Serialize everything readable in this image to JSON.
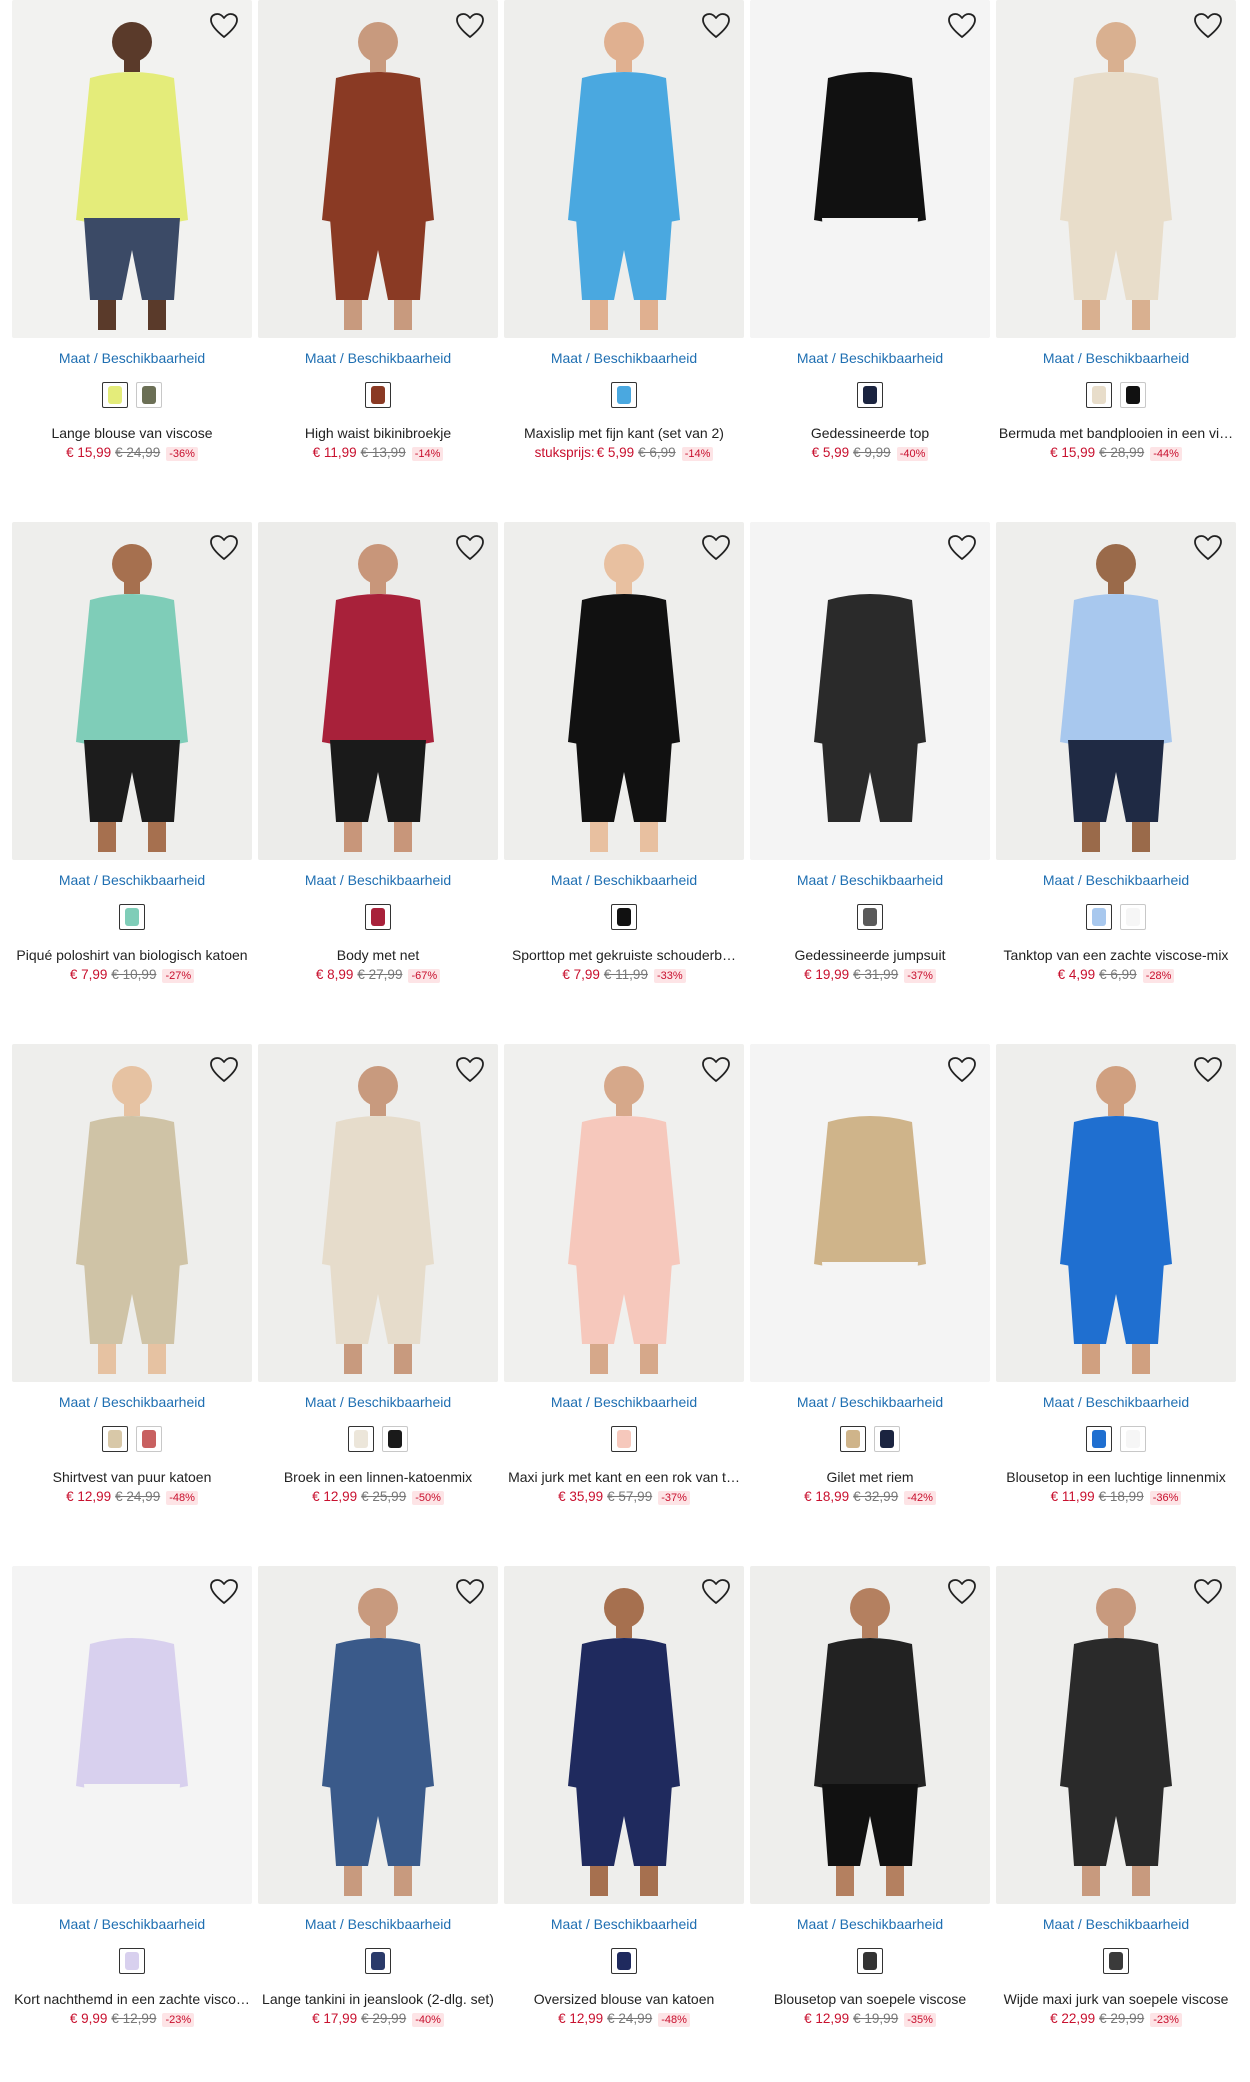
{
  "ui": {
    "maat_label": "Maat / Beschikbaarheid",
    "wishlist_icon": "heart-outline-icon",
    "colors": {
      "price": "#c8102e",
      "link": "#1f6fb2",
      "discount_bg": "#fde4e6"
    }
  },
  "products": [
    {
      "title": "Lange blouse van viscose",
      "price": "€ 15,99",
      "old_price": "€ 24,99",
      "discount": "-36%",
      "bg": "#f2f2f0",
      "main": "#e4ec7a",
      "skin": "#5a3a2a",
      "bottom": "#3b4a66",
      "swatches": [
        "#e4ec7a",
        "#6b6f55"
      ]
    },
    {
      "title": "High waist bikinibroekje",
      "price": "€ 11,99",
      "old_price": "€ 13,99",
      "discount": "-14%",
      "bg": "#eeeeec",
      "main": "#8a3a24",
      "skin": "#c89a7e",
      "bottom": "#8a3a24",
      "swatches": [
        "#8a3a24"
      ]
    },
    {
      "title": "Maxislip met fijn kant (set van 2)",
      "unit_label": "stuksprijs:",
      "price": "€ 5,99",
      "old_price": "€ 6,99",
      "discount": "-14%",
      "bg": "#eeeeec",
      "main": "#4aa8e0",
      "skin": "#e0b090",
      "bottom": "#4aa8e0",
      "swatches": [
        "#4aa8e0"
      ]
    },
    {
      "title": "Gedessineerde top",
      "price": "€ 5,99",
      "old_price": "€ 9,99",
      "discount": "-40%",
      "bg": "#f4f4f4",
      "main": "#111111",
      "skin": "#f4f4f4",
      "bottom": "#f4f4f4",
      "swatches": [
        "#1b2440"
      ]
    },
    {
      "title": "Bermuda met bandplooien in een vi…",
      "price": "€ 15,99",
      "old_price": "€ 28,99",
      "discount": "-44%",
      "bg": "#f0f0ee",
      "main": "#e8ddca",
      "skin": "#d9b090",
      "bottom": "#e8ddca",
      "swatches": [
        "#e8ddca",
        "#111111"
      ]
    },
    {
      "title": "Piqué poloshirt van biologisch katoen",
      "price": "€ 7,99",
      "old_price": "€ 10,99",
      "discount": "-27%",
      "bg": "#eeeeec",
      "main": "#7fcdb8",
      "skin": "#a6704f",
      "bottom": "#1c1c1c",
      "swatches": [
        "#7fcdb8"
      ]
    },
    {
      "title": "Body met net",
      "price": "€ 8,99",
      "old_price": "€ 27,99",
      "discount": "-67%",
      "bg": "#ececea",
      "main": "#a8213a",
      "skin": "#c8967a",
      "bottom": "#1a1a1a",
      "swatches": [
        "#a8213a"
      ]
    },
    {
      "title": "Sporttop met gekruiste schouderb…",
      "price": "€ 7,99",
      "old_price": "€ 11,99",
      "discount": "-33%",
      "bg": "#eeeeec",
      "main": "#111111",
      "skin": "#e8c0a0",
      "bottom": "#111111",
      "swatches": [
        "#111111"
      ]
    },
    {
      "title": "Gedessineerde jumpsuit",
      "price": "€ 19,99",
      "old_price": "€ 31,99",
      "discount": "-37%",
      "bg": "#f4f4f4",
      "main": "#2a2a2a",
      "skin": "#f4f4f4",
      "bottom": "#2a2a2a",
      "swatches": [
        "#5a5a5a"
      ]
    },
    {
      "title": "Tanktop van een zachte viscose-mix",
      "price": "€ 4,99",
      "old_price": "€ 6,99",
      "discount": "-28%",
      "bg": "#eeeeec",
      "main": "#a8c8ee",
      "skin": "#9a6a4a",
      "bottom": "#1f2a44",
      "swatches": [
        "#a8c8ee",
        "#f6f6f6"
      ]
    },
    {
      "title": "Shirtvest van puur katoen",
      "price": "€ 12,99",
      "old_price": "€ 24,99",
      "discount": "-48%",
      "bg": "#eeeeec",
      "main": "#cfc3a6",
      "skin": "#e6c2a2",
      "bottom": "#cfc3a6",
      "swatches": [
        "#d8c8a8",
        "#c86060"
      ]
    },
    {
      "title": "Broek in een linnen-katoenmix",
      "price": "€ 12,99",
      "old_price": "€ 25,99",
      "discount": "-50%",
      "bg": "#eeeeec",
      "main": "#e6dccb",
      "skin": "#c89a7e",
      "bottom": "#e6dccb",
      "swatches": [
        "#ece6da",
        "#1a1a1a"
      ]
    },
    {
      "title": "Maxi jurk met kant en een rok van t…",
      "price": "€ 35,99",
      "old_price": "€ 57,99",
      "discount": "-37%",
      "bg": "#f0f0ee",
      "main": "#f6c8bc",
      "skin": "#d6a88a",
      "bottom": "#f6c8bc",
      "swatches": [
        "#f6c8bc"
      ]
    },
    {
      "title": "Gilet met riem",
      "price": "€ 18,99",
      "old_price": "€ 32,99",
      "discount": "-42%",
      "bg": "#f4f4f4",
      "main": "#cfb48a",
      "skin": "#f4f4f4",
      "bottom": "#f4f4f4",
      "swatches": [
        "#cfb48a",
        "#1b2440"
      ]
    },
    {
      "title": "Blousetop in een luchtige linnenmix",
      "price": "€ 11,99",
      "old_price": "€ 18,99",
      "discount": "-36%",
      "bg": "#eeeeec",
      "main": "#1f6fd0",
      "skin": "#d0a080",
      "bottom": "#1f6fd0",
      "swatches": [
        "#1f6fd0",
        "#f6f6f6"
      ]
    },
    {
      "title": "Kort nachthemd in een zachte visco…",
      "price": "€ 9,99",
      "old_price": "€ 12,99",
      "discount": "-23%",
      "bg": "#f4f4f4",
      "main": "#d8d0ee",
      "skin": "#f4f4f4",
      "bottom": "#f4f4f4",
      "swatches": [
        "#d8d0ee"
      ]
    },
    {
      "title": "Lange tankini in jeanslook (2-dlg. set)",
      "price": "€ 17,99",
      "old_price": "€ 29,99",
      "discount": "-40%",
      "bg": "#eeeeec",
      "main": "#3a5a8a",
      "skin": "#c89a7e",
      "bottom": "#3a5a8a",
      "swatches": [
        "#2a3a6a"
      ]
    },
    {
      "title": "Oversized blouse van katoen",
      "price": "€ 12,99",
      "old_price": "€ 24,99",
      "discount": "-48%",
      "bg": "#eeeeec",
      "main": "#1f2a5e",
      "skin": "#a6704f",
      "bottom": "#1f2a5e",
      "swatches": [
        "#1f2a5e"
      ]
    },
    {
      "title": "Blousetop van soepele viscose",
      "price": "€ 12,99",
      "old_price": "€ 19,99",
      "discount": "-35%",
      "bg": "#eeeeec",
      "main": "#222222",
      "skin": "#b48060",
      "bottom": "#111111",
      "swatches": [
        "#333333"
      ]
    },
    {
      "title": "Wijde maxi jurk van soepele viscose",
      "price": "€ 22,99",
      "old_price": "€ 29,99",
      "discount": "-23%",
      "bg": "#eeeeec",
      "main": "#2a2a2a",
      "skin": "#c89a7e",
      "bottom": "#2a2a2a",
      "swatches": [
        "#3a3a3a"
      ]
    }
  ]
}
